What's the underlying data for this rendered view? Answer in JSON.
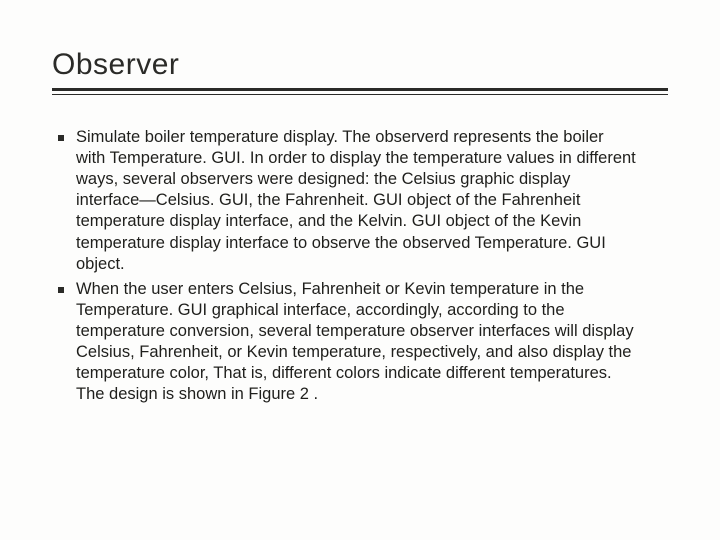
{
  "slide": {
    "title": "Observer",
    "bullets": [
      "Simulate boiler temperature display. The observerd represents the boiler with Temperature. GUI. In order to display the temperature values in different ways, several observers were designed: the Celsius graphic display interface—Celsius. GUI, the Fahrenheit. GUI object of the Fahrenheit temperature display interface, and the Kelvin. GUI object of the Kevin temperature display interface to observe the observed Temperature. GUI object.",
      "When the user enters Celsius, Fahrenheit or Kevin temperature in the Temperature. GUI graphical interface, accordingly, according to the temperature conversion, several temperature observer interfaces will display Celsius, Fahrenheit, or Kevin temperature, respectively, and also display the temperature color, That is, different colors indicate different temperatures. The design is shown in Figure 2 ."
    ]
  }
}
